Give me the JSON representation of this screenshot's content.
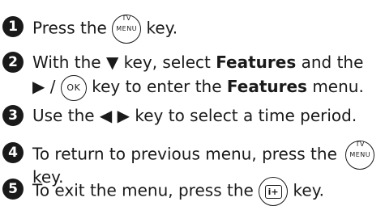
{
  "intro_fragment": "",
  "steps": [
    {
      "num": "1",
      "pre": "Press the",
      "post": "key."
    },
    {
      "num": "2",
      "a": "With the ▼ key, select",
      "b": "Features",
      "c": "and the",
      "d": "▶ /",
      "e": "key to enter the",
      "f": "Features",
      "g": "menu."
    },
    {
      "num": "3",
      "text": "Use the ◀  ▶ key to select a time period."
    },
    {
      "num": "4",
      "pre": "To return to previous menu, press the",
      "line2": "key."
    },
    {
      "num": "5",
      "pre": "To exit the menu, press the",
      "post": "key."
    }
  ],
  "keys": {
    "menu": "MENU",
    "tv": "TV",
    "ok": "OK",
    "info": "i+"
  }
}
